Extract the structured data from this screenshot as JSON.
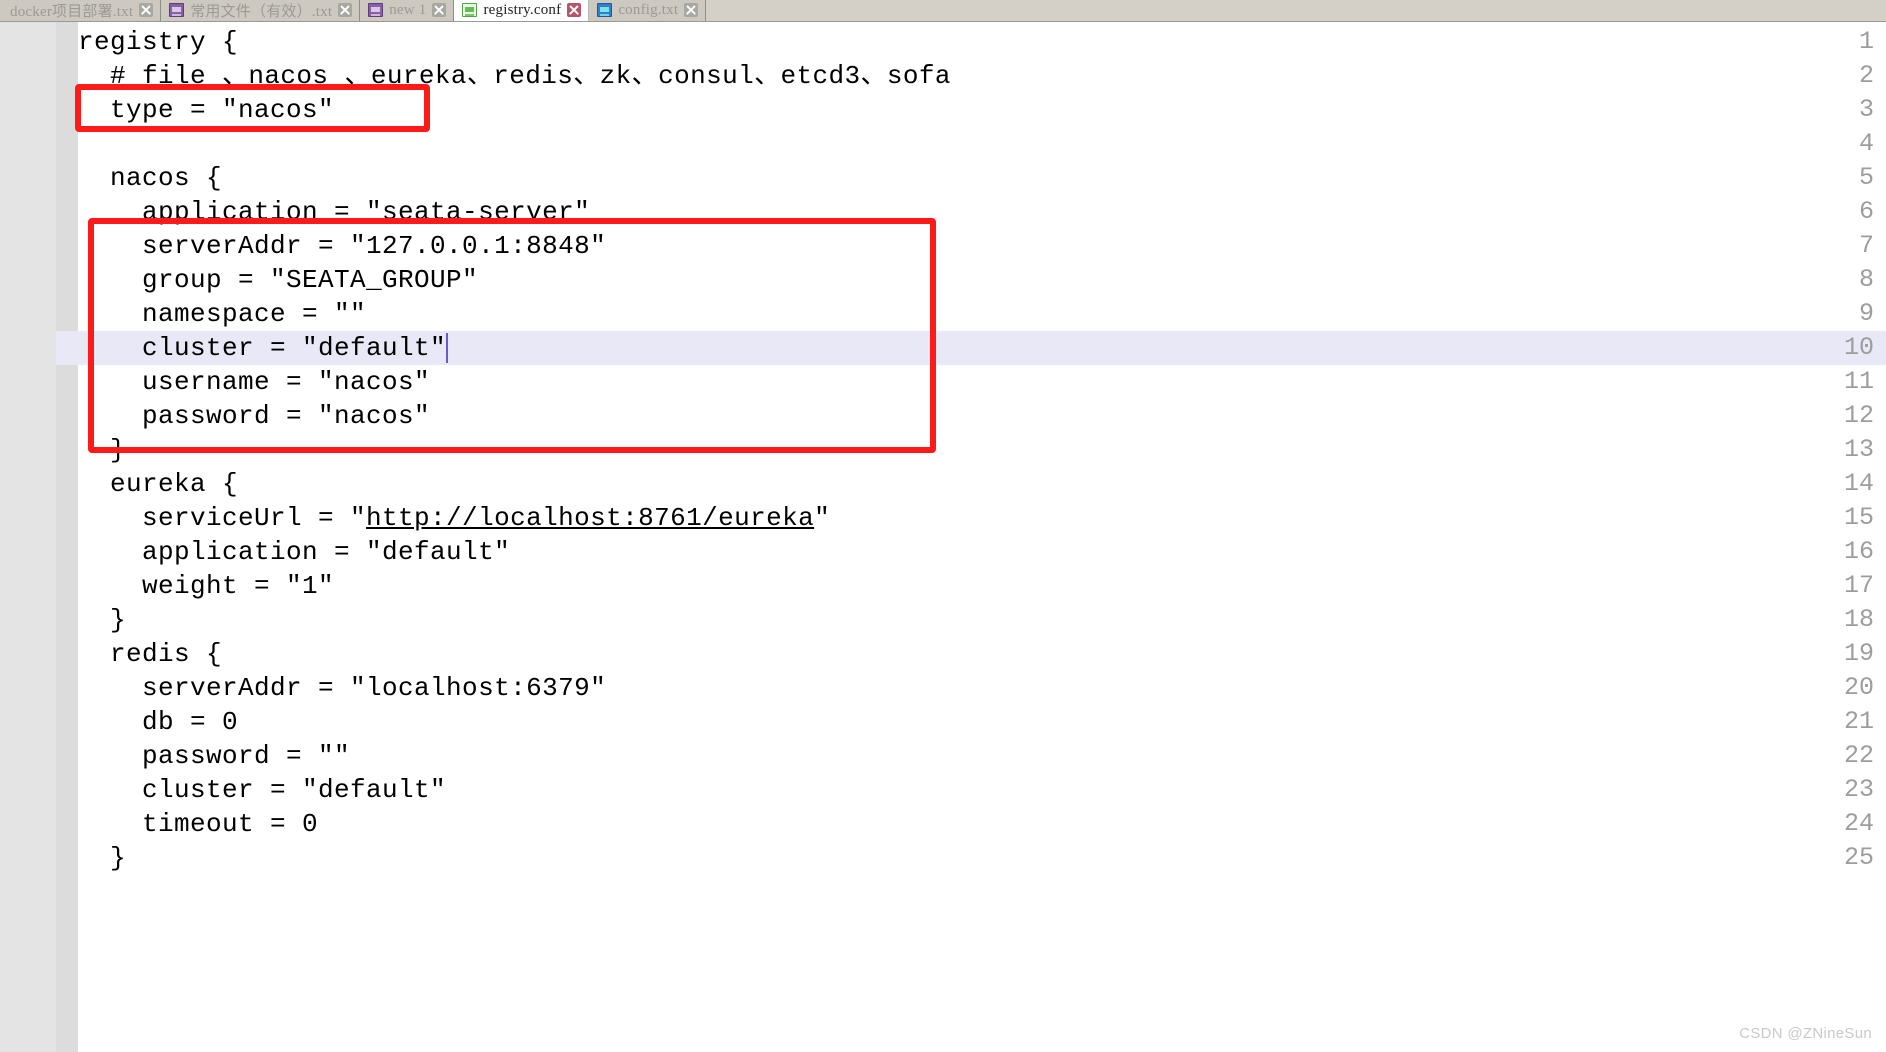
{
  "window": {
    "active_document": "registry.conf"
  },
  "tabbar": {
    "tabs": [
      {
        "label": "docker项目部署.txt",
        "icon": "document-icon-purple",
        "active": false,
        "close_label": "close-tab"
      },
      {
        "label": "常用文件（有效）.txt",
        "icon": "document-icon-purple",
        "active": false,
        "close_label": "close-tab"
      },
      {
        "label": "new 1",
        "icon": "document-icon-purple",
        "active": false,
        "close_label": "close-tab"
      },
      {
        "label": "registry.conf",
        "icon": "document-icon-green",
        "active": true,
        "close_label": "close-tab"
      },
      {
        "label": "config.txt",
        "icon": "document-icon-blue",
        "active": false,
        "close_label": "close-tab"
      }
    ]
  },
  "editor": {
    "current_line": 10,
    "caret_line": 10,
    "line_numbers": [
      "1",
      "2",
      "3",
      "4",
      "5",
      "6",
      "7",
      "8",
      "9",
      "10",
      "11",
      "12",
      "13",
      "14",
      "15",
      "16",
      "17",
      "18",
      "19",
      "20",
      "21",
      "22",
      "23",
      "24",
      "25"
    ],
    "lines": [
      {
        "n": 1,
        "text": "registry {"
      },
      {
        "n": 2,
        "text": "  # file 、nacos 、eureka、redis、zk、consul、etcd3、sofa"
      },
      {
        "n": 3,
        "text": "  type = \"nacos\""
      },
      {
        "n": 4,
        "text": ""
      },
      {
        "n": 5,
        "text": "  nacos {"
      },
      {
        "n": 6,
        "text": "    application = \"seata-server\""
      },
      {
        "n": 7,
        "text": "    serverAddr = \"127.0.0.1:8848\""
      },
      {
        "n": 8,
        "text": "    group = \"SEATA_GROUP\""
      },
      {
        "n": 9,
        "text": "    namespace = \"\""
      },
      {
        "n": 10,
        "text": "    cluster = \"default\""
      },
      {
        "n": 11,
        "text": "    username = \"nacos\""
      },
      {
        "n": 12,
        "text": "    password = \"nacos\""
      },
      {
        "n": 13,
        "text": "  }"
      },
      {
        "n": 14,
        "text": "  eureka {"
      },
      {
        "n": 15,
        "text": "    serviceUrl = \"",
        "url": "http://localhost:8761/eureka",
        "text_after": "\""
      },
      {
        "n": 16,
        "text": "    application = \"default\""
      },
      {
        "n": 17,
        "text": "    weight = \"1\""
      },
      {
        "n": 18,
        "text": "  }"
      },
      {
        "n": 19,
        "text": "  redis {"
      },
      {
        "n": 20,
        "text": "    serverAddr = \"localhost:6379\""
      },
      {
        "n": 21,
        "text": "    db = 0"
      },
      {
        "n": 22,
        "text": "    password = \"\""
      },
      {
        "n": 23,
        "text": "    cluster = \"default\""
      },
      {
        "n": 24,
        "text": "    timeout = 0"
      },
      {
        "n": 25,
        "text": "  }"
      }
    ]
  },
  "annotations": {
    "boxes": [
      {
        "name": "highlight-box-type",
        "label": "type = \"nacos\""
      },
      {
        "name": "highlight-box-nacos-block",
        "label": "nacos block properties"
      }
    ],
    "color": "#ff1a1a"
  },
  "watermark": {
    "text": "CSDN @ZNineSun"
  },
  "colors": {
    "annotation_red": "#ff1a1a",
    "current_line": "#e8e8f7",
    "gutter": "#e4e4e4",
    "line_number": "#9d9d9d",
    "caret": "#6a5acd",
    "tab_bar": "#d4d0c8",
    "active_tab": "#ffffff"
  }
}
